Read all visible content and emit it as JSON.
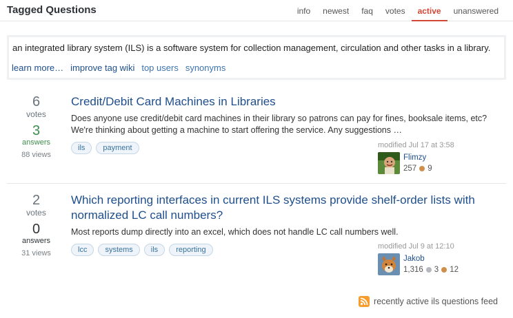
{
  "header": {
    "title": "Tagged Questions",
    "tabs": [
      {
        "label": "info",
        "active": false
      },
      {
        "label": "newest",
        "active": false
      },
      {
        "label": "faq",
        "active": false
      },
      {
        "label": "votes",
        "active": false
      },
      {
        "label": "active",
        "active": true
      },
      {
        "label": "unanswered",
        "active": false
      }
    ]
  },
  "tag_wiki": {
    "excerpt": "an integrated library system (ILS) is a software system for collection management, circulation and other tasks in a library.",
    "links": [
      {
        "label": "learn more…"
      },
      {
        "label": "improve tag wiki"
      },
      {
        "label": "top users"
      },
      {
        "label": "synonyms"
      }
    ]
  },
  "questions": [
    {
      "votes": "6",
      "votes_label": "votes",
      "answers": "3",
      "answers_label": "answers",
      "views": "88 views",
      "title": "Credit/Debit Card Machines in Libraries",
      "excerpt": "Does anyone use credit/debit card machines in their library so patrons can pay for fines, booksale items, etc? We're thinking about getting a machine to start offering the service. Any suggestions …",
      "tags": [
        "ils",
        "payment"
      ],
      "modified_label": "modified",
      "modified_time": "Jul 17 at 3:58",
      "user": {
        "name": "Flimzy",
        "reputation": "257",
        "bronze": "9",
        "avatar_icon": "user-avatar-flimzy"
      }
    },
    {
      "votes": "2",
      "votes_label": "votes",
      "answers": "0",
      "answers_label": "answers",
      "views": "31 views",
      "title": "Which reporting interfaces in current ILS systems provide shelf-order lists with normalized LC call numbers?",
      "excerpt": "Most reports dump directly into an excel, which does not handle LC call numbers well.",
      "tags": [
        "lcc",
        "systems",
        "ils",
        "reporting"
      ],
      "modified_label": "modified",
      "modified_time": "Jul 9 at 12:10",
      "user": {
        "name": "Jakob",
        "reputation": "1,316",
        "silver": "3",
        "bronze": "12",
        "avatar_icon": "user-avatar-jakob"
      }
    }
  ],
  "feed": {
    "label": "recently active ils questions feed",
    "icon": "rss-icon"
  },
  "colors": {
    "link": "#1e4e8c",
    "active_tab": "#d14836",
    "answered_green": "#3f8b4b",
    "rss_orange": "#f79d2d"
  }
}
